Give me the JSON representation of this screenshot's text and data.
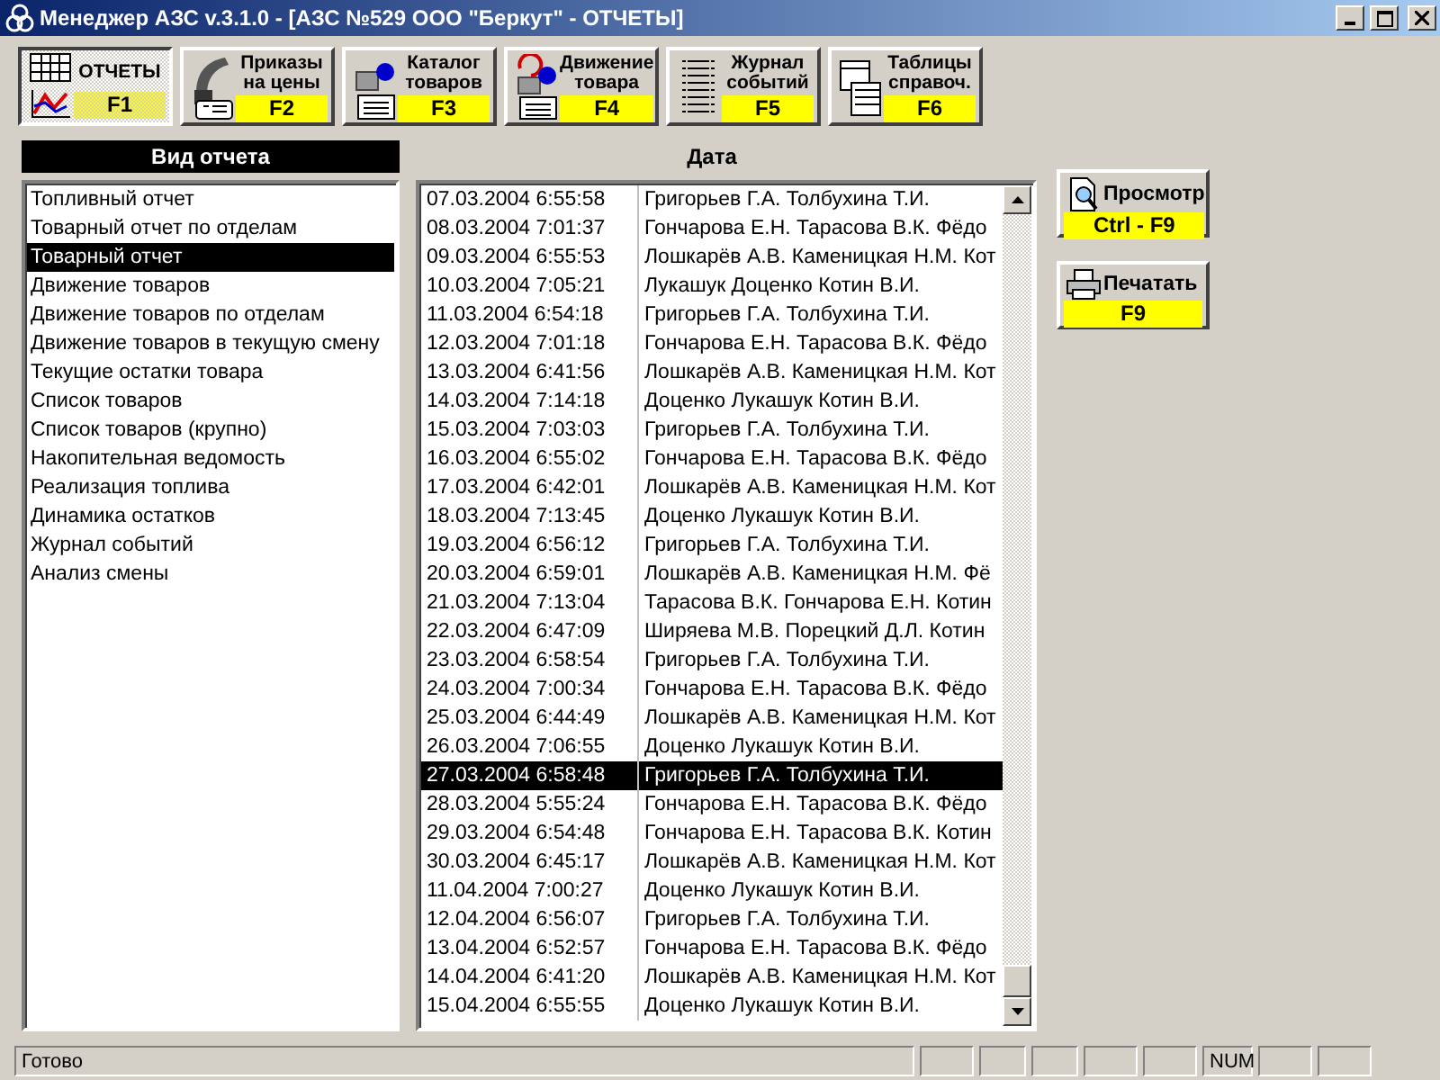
{
  "window": {
    "title": "Менеджер АЗС v.3.1.0 - [АЗС №529 ООО \"Беркут\" - ОТЧЕТЫ]"
  },
  "toolbar": [
    {
      "kind": "reports",
      "label": "ОТЧЕТЫ",
      "key": "F1",
      "selected": true
    },
    {
      "kind": "prices",
      "label": "Приказы\nна цены",
      "key": "F2",
      "selected": false
    },
    {
      "kind": "catalog",
      "label": "Каталог\nтоваров",
      "key": "F3",
      "selected": false
    },
    {
      "kind": "movement",
      "label": "Движение\nтовара",
      "key": "F4",
      "selected": false
    },
    {
      "kind": "journal",
      "label": "Журнал\nсобытий",
      "key": "F5",
      "selected": false
    },
    {
      "kind": "tables",
      "label": "Таблицы\nсправоч.",
      "key": "F6",
      "selected": false
    }
  ],
  "report_types": {
    "header": "Вид отчета",
    "items": [
      {
        "label": "Топливный отчет",
        "selected": false
      },
      {
        "label": "Товарный отчет по отделам",
        "selected": false
      },
      {
        "label": "Товарный отчет",
        "selected": true
      },
      {
        "label": "Движение товаров",
        "selected": false
      },
      {
        "label": "Движение товаров по отделам",
        "selected": false
      },
      {
        "label": "Движение товаров в текущую смену",
        "selected": false
      },
      {
        "label": "Текущие остатки товара",
        "selected": false
      },
      {
        "label": "Список товаров",
        "selected": false
      },
      {
        "label": "Список товаров (крупно)",
        "selected": false
      },
      {
        "label": "Накопительная ведомость",
        "selected": false
      },
      {
        "label": "Реализация топлива",
        "selected": false
      },
      {
        "label": "Динамика остатков",
        "selected": false
      },
      {
        "label": "Журнал событий",
        "selected": false
      },
      {
        "label": "Анализ смены",
        "selected": false
      }
    ]
  },
  "shifts": {
    "header": "Дата",
    "rows": [
      {
        "date": "07.03.2004 6:55:58",
        "staff": "Григорьев Г.А. Толбухина Т.И.",
        "selected": false
      },
      {
        "date": "08.03.2004 7:01:37",
        "staff": "Гончарова Е.Н. Тарасова В.К. Фёдо",
        "selected": false
      },
      {
        "date": "09.03.2004 6:55:53",
        "staff": "Лошкарёв А.В. Каменицкая Н.М. Кот",
        "selected": false
      },
      {
        "date": "10.03.2004 7:05:21",
        "staff": "Лукашук Доценко Котин В.И.",
        "selected": false
      },
      {
        "date": "11.03.2004 6:54:18",
        "staff": "Григорьев Г.А. Толбухина Т.И.",
        "selected": false
      },
      {
        "date": "12.03.2004 7:01:18",
        "staff": "Гончарова Е.Н. Тарасова В.К. Фёдо",
        "selected": false
      },
      {
        "date": "13.03.2004 6:41:56",
        "staff": "Лошкарёв А.В. Каменицкая Н.М. Кот",
        "selected": false
      },
      {
        "date": "14.03.2004 7:14:18",
        "staff": "Доценко Лукашук Котин В.И.",
        "selected": false
      },
      {
        "date": "15.03.2004 7:03:03",
        "staff": "Григорьев Г.А. Толбухина Т.И.",
        "selected": false
      },
      {
        "date": "16.03.2004 6:55:02",
        "staff": "Гончарова Е.Н. Тарасова В.К. Фёдо",
        "selected": false
      },
      {
        "date": "17.03.2004 6:42:01",
        "staff": "Лошкарёв А.В. Каменицкая Н.М. Кот",
        "selected": false
      },
      {
        "date": "18.03.2004 7:13:45",
        "staff": "Доценко Лукашук Котин В.И.",
        "selected": false
      },
      {
        "date": "19.03.2004 6:56:12",
        "staff": "Григорьев Г.А. Толбухина Т.И.",
        "selected": false
      },
      {
        "date": "20.03.2004 6:59:01",
        "staff": "Лошкарёв А.В. Каменицкая Н.М. Фё",
        "selected": false
      },
      {
        "date": "21.03.2004 7:13:04",
        "staff": "Тарасова В.К. Гончарова Е.Н. Котин",
        "selected": false
      },
      {
        "date": "22.03.2004 6:47:09",
        "staff": "Ширяева М.В. Порецкий Д.Л. Котин",
        "selected": false
      },
      {
        "date": "23.03.2004 6:58:54",
        "staff": "Григорьев Г.А. Толбухина Т.И.",
        "selected": false
      },
      {
        "date": "24.03.2004 7:00:34",
        "staff": "Гончарова Е.Н. Тарасова В.К. Фёдо",
        "selected": false
      },
      {
        "date": "25.03.2004 6:44:49",
        "staff": "Лошкарёв А.В. Каменицкая Н.М. Кот",
        "selected": false
      },
      {
        "date": "26.03.2004 7:06:55",
        "staff": "Доценко Лукашук Котин В.И.",
        "selected": false
      },
      {
        "date": "27.03.2004 6:58:48",
        "staff": "Григорьев Г.А. Толбухина Т.И.",
        "selected": true
      },
      {
        "date": "28.03.2004 5:55:24",
        "staff": "Гончарова Е.Н. Тарасова В.К. Фёдо",
        "selected": false
      },
      {
        "date": "29.03.2004 6:54:48",
        "staff": "Гончарова Е.Н. Тарасова В.К. Котин",
        "selected": false
      },
      {
        "date": "30.03.2004 6:45:17",
        "staff": "Лошкарёв А.В. Каменицкая Н.М. Кот",
        "selected": false
      },
      {
        "date": "11.04.2004 7:00:27",
        "staff": "Доценко Лукашук Котин В.И.",
        "selected": false
      },
      {
        "date": "12.04.2004 6:56:07",
        "staff": "Григорьев Г.А. Толбухина Т.И.",
        "selected": false
      },
      {
        "date": "13.04.2004 6:52:57",
        "staff": "Гончарова Е.Н. Тарасова В.К. Фёдо",
        "selected": false
      },
      {
        "date": "14.04.2004 6:41:20",
        "staff": "Лошкарёв А.В. Каменицкая Н.М. Кот",
        "selected": false
      },
      {
        "date": "15.04.2004 6:55:55",
        "staff": "Доценко Лукашук Котин В.И.",
        "selected": false
      }
    ]
  },
  "actions": [
    {
      "kind": "preview",
      "label": "Просмотр",
      "key": "Ctrl - F9"
    },
    {
      "kind": "print",
      "label": "Печатать",
      "key": "F9"
    }
  ],
  "status_bar": {
    "message": "Готово",
    "indicators": [
      {
        "label": "NUM"
      }
    ]
  }
}
